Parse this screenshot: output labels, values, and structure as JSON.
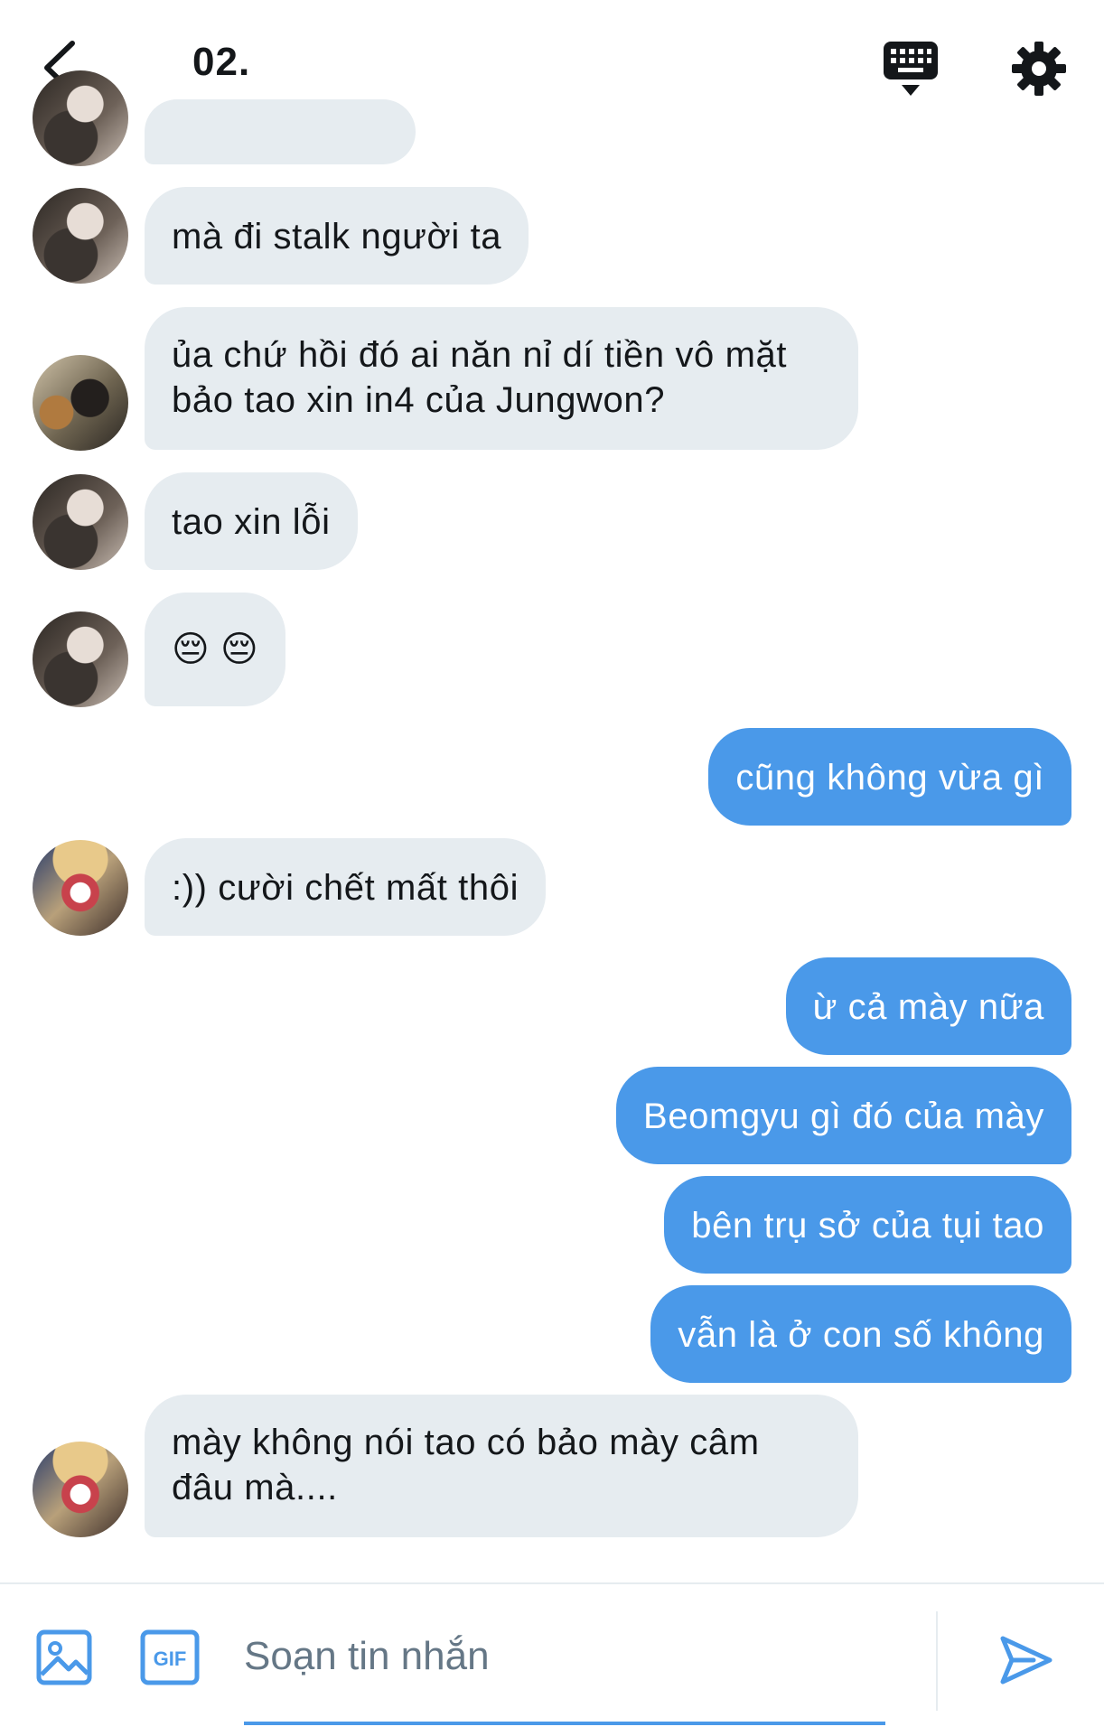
{
  "header": {
    "title": "02."
  },
  "icons": {
    "back": "chevron-left-icon",
    "keyboard": "keyboard-icon",
    "settings": "gear-icon",
    "image": "image-icon",
    "gif": "gif-icon",
    "send": "send-icon"
  },
  "colors": {
    "accent": "#4a99e9",
    "incoming_bubble": "#e6ecf0",
    "text": "#14171a",
    "placeholder": "#657786"
  },
  "messages": [
    {
      "direction": "in",
      "text": "mà đi stalk người ta"
    },
    {
      "direction": "in",
      "text": "ủa chứ hồi đó ai năn nỉ dí tiền vô mặt bảo tao xin in4 của Jungwon?"
    },
    {
      "direction": "in",
      "text": "tao xin lỗi"
    },
    {
      "direction": "in",
      "text": "😔 😔"
    },
    {
      "direction": "out",
      "text": "cũng không vừa gì"
    },
    {
      "direction": "in",
      "text": ":)) cười chết mất thôi"
    },
    {
      "direction": "out",
      "text": "ừ cả mày nữa"
    },
    {
      "direction": "out",
      "text": "Beomgyu gì đó của mày"
    },
    {
      "direction": "out",
      "text": "bên trụ sở của tụi tao"
    },
    {
      "direction": "out",
      "text": "vẫn là ở con số không"
    },
    {
      "direction": "in",
      "text": "mày không nói tao có bảo mày câm đâu mà...."
    }
  ],
  "composer": {
    "placeholder": "Soạn tin nhắn",
    "value": "",
    "gif_label": "GIF"
  }
}
